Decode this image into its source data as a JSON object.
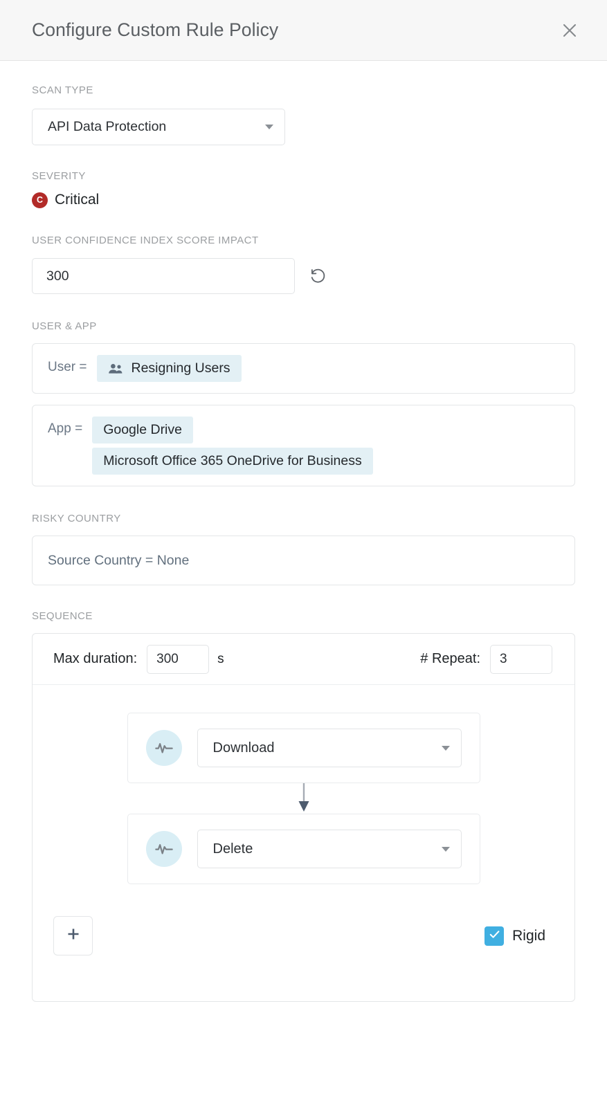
{
  "header": {
    "title": "Configure Custom Rule Policy",
    "close_icon": "close-icon"
  },
  "scan_type": {
    "label": "SCAN TYPE",
    "value": "API Data Protection",
    "caret_icon": "chevron-down-icon"
  },
  "severity": {
    "label": "SEVERITY",
    "badge_letter": "C",
    "badge_color": "#b22b28",
    "value": "Critical"
  },
  "uci_score": {
    "label": "USER CONFIDENCE INDEX SCORE IMPACT",
    "value": "300",
    "placeholder": "Score",
    "reset_icon": "reset-rotate-ccw-icon"
  },
  "user_app": {
    "label": "USER & APP",
    "user": {
      "key": "User =",
      "chips": [
        {
          "text": "Resigning Users",
          "icon": "users-group-icon"
        }
      ]
    },
    "app": {
      "key": "App =",
      "chips": [
        {
          "text": "Google Drive",
          "icon": ""
        },
        {
          "text": "Microsoft Office 365 OneDrive for Business",
          "icon": ""
        }
      ]
    }
  },
  "risky_country": {
    "label": "RISKY COUNTRY",
    "value": "Source Country = None"
  },
  "sequence": {
    "label": "SEQUENCE",
    "max_duration_label": "Max duration:",
    "max_duration_value": "300",
    "max_duration_unit": "s",
    "repeat_label": "# Repeat:",
    "repeat_value": "3",
    "steps": [
      {
        "icon": "activity-pulse-icon",
        "value": "Download",
        "caret_icon": "chevron-down-icon"
      },
      {
        "icon": "activity-pulse-icon",
        "value": "Delete",
        "caret_icon": "chevron-down-icon"
      }
    ],
    "connector_icon": "arrow-down-icon",
    "add_button_icon": "plus-icon",
    "rigid": {
      "label": "Rigid",
      "checked": true,
      "checkbox_color": "#40afe1",
      "check_icon": "checkmark-icon"
    }
  },
  "colors": {
    "accent": "#40afe1",
    "chip_bg": "#e3f0f5",
    "step_icon_bg": "#d9eef5",
    "critical": "#b22b28",
    "header_bg": "#f7f7f7"
  }
}
